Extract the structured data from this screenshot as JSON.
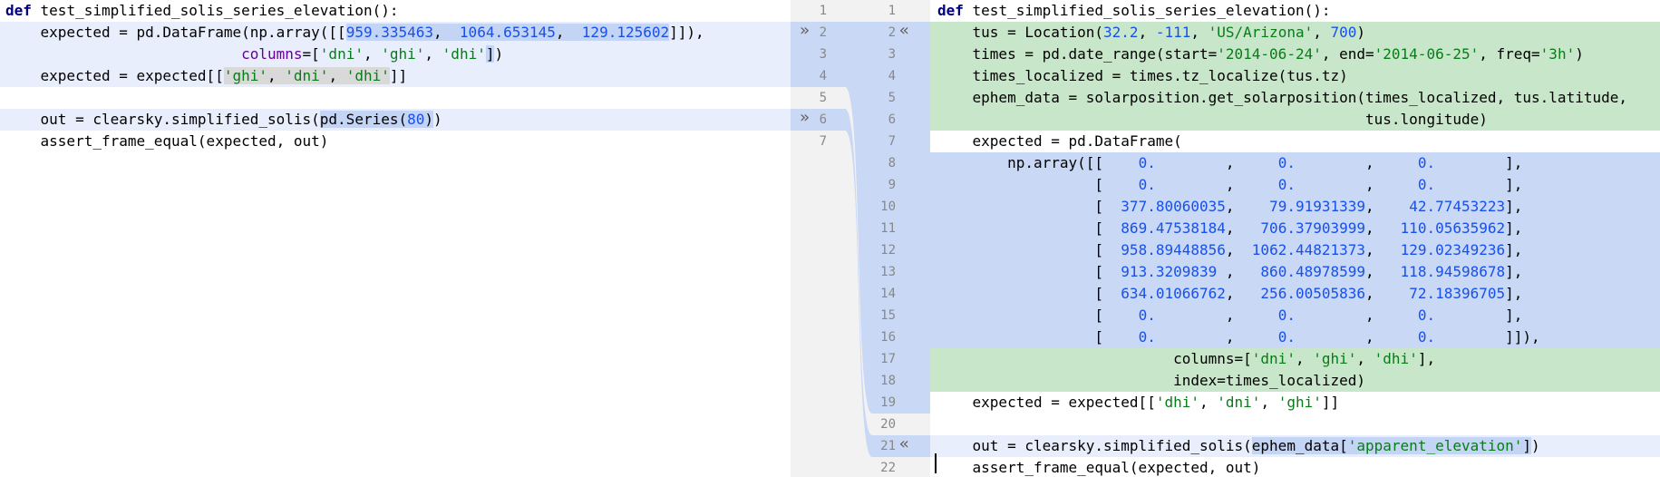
{
  "left": {
    "lines": [
      {
        "n": "1",
        "parts": [
          [
            "kw",
            "def"
          ],
          [
            "",
            " test_simplified_solis_series_elevation():"
          ]
        ]
      },
      {
        "n": "2",
        "parts": [
          [
            "",
            "    expected = pd.DataFrame(np.array([["
          ],
          [
            "num chg",
            "959.335463"
          ],
          [
            "chg",
            ",  "
          ],
          [
            "num chg",
            "1064.653145"
          ],
          [
            "chg",
            ",  "
          ],
          [
            "num chg",
            "129.125602"
          ],
          [
            "",
            "]]),"
          ]
        ]
      },
      {
        "n": "3",
        "parts": [
          [
            "",
            "                           "
          ],
          [
            "kwarg",
            "columns"
          ],
          [
            "",
            "=["
          ],
          [
            "str",
            "'dni'"
          ],
          [
            "",
            ", "
          ],
          [
            "str",
            "'ghi'"
          ],
          [
            "",
            ", "
          ],
          [
            "str",
            "'dhi'"
          ],
          [
            "chg",
            "]"
          ],
          [
            "",
            ")"
          ]
        ]
      },
      {
        "n": "4",
        "parts": [
          [
            "",
            "    expected = expected[["
          ],
          [
            "str grey",
            "'ghi'"
          ],
          [
            "grey",
            ", "
          ],
          [
            "str grey",
            "'dni'"
          ],
          [
            "grey",
            ", "
          ],
          [
            "str grey",
            "'dhi'"
          ],
          [
            "",
            "]]"
          ]
        ]
      },
      {
        "n": "5",
        "parts": [
          [
            "",
            ""
          ]
        ]
      },
      {
        "n": "6",
        "parts": [
          [
            "",
            "    out = clearsky.simplified_solis("
          ],
          [
            "chg",
            "pd.Series("
          ],
          [
            "num chg",
            "80"
          ],
          [
            "chg",
            ")"
          ],
          [
            "",
            ")"
          ]
        ]
      },
      {
        "n": "7",
        "parts": [
          [
            "",
            "    assert_frame_equal(expected, out)"
          ]
        ]
      }
    ]
  },
  "right": {
    "lines": [
      {
        "n": "1",
        "parts": [
          [
            "kw",
            "def"
          ],
          [
            "",
            " test_simplified_solis_series_elevation():"
          ]
        ]
      },
      {
        "n": "2",
        "parts": [
          [
            "",
            "    tus = Location("
          ],
          [
            "num",
            "32.2"
          ],
          [
            "",
            ", "
          ],
          [
            "num",
            "-111"
          ],
          [
            "",
            ", "
          ],
          [
            "str",
            "'US/Arizona'"
          ],
          [
            "",
            ", "
          ],
          [
            "num",
            "700"
          ],
          [
            "",
            ")"
          ]
        ]
      },
      {
        "n": "3",
        "parts": [
          [
            "",
            "    times = pd.date_range(start="
          ],
          [
            "str",
            "'2014-06-24'"
          ],
          [
            "",
            ", end="
          ],
          [
            "str",
            "'2014-06-25'"
          ],
          [
            "",
            ", freq="
          ],
          [
            "str",
            "'3h'"
          ],
          [
            "",
            ")"
          ]
        ]
      },
      {
        "n": "4",
        "parts": [
          [
            "",
            "    times_localized = times.tz_localize(tus.tz)"
          ]
        ]
      },
      {
        "n": "5",
        "parts": [
          [
            "",
            "    ephem_data = solarposition.get_solarposition(times_localized, tus.latitude,"
          ]
        ]
      },
      {
        "n": "6",
        "parts": [
          [
            "",
            "                                                 tus.longitude)"
          ]
        ]
      },
      {
        "n": "7",
        "parts": [
          [
            "",
            "    expected = pd.DataFrame("
          ]
        ]
      },
      {
        "n": "8",
        "parts": [
          [
            "",
            "        np.array([["
          ],
          [
            "num",
            "    0.        "
          ],
          [
            "",
            ",     "
          ],
          [
            "num",
            "0.        "
          ],
          [
            "",
            ",     "
          ],
          [
            "num",
            "0.        "
          ],
          [
            "",
            "],"
          ]
        ]
      },
      {
        "n": "9",
        "parts": [
          [
            "",
            "                  [    "
          ],
          [
            "num",
            "0.        "
          ],
          [
            "",
            ",     "
          ],
          [
            "num",
            "0.        "
          ],
          [
            "",
            ",     "
          ],
          [
            "num",
            "0.        "
          ],
          [
            "",
            "],"
          ]
        ]
      },
      {
        "n": "10",
        "parts": [
          [
            "",
            "                  [  "
          ],
          [
            "num",
            "377.80060035"
          ],
          [
            "",
            ",    "
          ],
          [
            "num",
            "79.91931339"
          ],
          [
            "",
            ",    "
          ],
          [
            "num",
            "42.77453223"
          ],
          [
            "",
            "],"
          ]
        ]
      },
      {
        "n": "11",
        "parts": [
          [
            "",
            "                  [  "
          ],
          [
            "num",
            "869.47538184"
          ],
          [
            "",
            ",   "
          ],
          [
            "num",
            "706.37903999"
          ],
          [
            "",
            ",   "
          ],
          [
            "num",
            "110.05635962"
          ],
          [
            "",
            "],"
          ]
        ]
      },
      {
        "n": "12",
        "parts": [
          [
            "",
            "                  [  "
          ],
          [
            "num",
            "958.89448856"
          ],
          [
            "",
            ",  "
          ],
          [
            "num",
            "1062.44821373"
          ],
          [
            "",
            ",   "
          ],
          [
            "num",
            "129.02349236"
          ],
          [
            "",
            "],"
          ]
        ]
      },
      {
        "n": "13",
        "parts": [
          [
            "",
            "                  [  "
          ],
          [
            "num",
            "913.3209839 "
          ],
          [
            "",
            ",   "
          ],
          [
            "num",
            "860.48978599"
          ],
          [
            "",
            ",   "
          ],
          [
            "num",
            "118.94598678"
          ],
          [
            "",
            "],"
          ]
        ]
      },
      {
        "n": "14",
        "parts": [
          [
            "",
            "                  [  "
          ],
          [
            "num",
            "634.01066762"
          ],
          [
            "",
            ",   "
          ],
          [
            "num",
            "256.00505836"
          ],
          [
            "",
            ",    "
          ],
          [
            "num",
            "72.18396705"
          ],
          [
            "",
            "],"
          ]
        ]
      },
      {
        "n": "15",
        "parts": [
          [
            "",
            "                  [    "
          ],
          [
            "num",
            "0.        "
          ],
          [
            "",
            ",     "
          ],
          [
            "num",
            "0.        "
          ],
          [
            "",
            ",     "
          ],
          [
            "num",
            "0.        "
          ],
          [
            "",
            "],"
          ]
        ]
      },
      {
        "n": "16",
        "parts": [
          [
            "",
            "                  [    "
          ],
          [
            "num",
            "0.        "
          ],
          [
            "",
            ",     "
          ],
          [
            "num",
            "0.        "
          ],
          [
            "",
            ",     "
          ],
          [
            "num",
            "0.        "
          ],
          [
            "",
            "]]),"
          ]
        ]
      },
      {
        "n": "17",
        "parts": [
          [
            "",
            "                           columns=["
          ],
          [
            "str",
            "'dni'"
          ],
          [
            "",
            ", "
          ],
          [
            "str",
            "'ghi'"
          ],
          [
            "",
            ", "
          ],
          [
            "str",
            "'dhi'"
          ],
          [
            "",
            "],"
          ]
        ]
      },
      {
        "n": "18",
        "parts": [
          [
            "",
            "                           index=times_localized)"
          ]
        ]
      },
      {
        "n": "19",
        "parts": [
          [
            "",
            "    expected = expected[["
          ],
          [
            "str",
            "'dhi'"
          ],
          [
            "",
            ", "
          ],
          [
            "str",
            "'dni'"
          ],
          [
            "",
            ", "
          ],
          [
            "str",
            "'ghi'"
          ],
          [
            "",
            "]]"
          ]
        ]
      },
      {
        "n": "20",
        "parts": [
          [
            "",
            ""
          ]
        ]
      },
      {
        "n": "21",
        "parts": [
          [
            "",
            "    out = clearsky.simplified_solis("
          ],
          [
            "chg",
            "ephem_data["
          ],
          [
            "str chg",
            "'apparent_elevation'"
          ],
          [
            "chg",
            "]"
          ],
          [
            "",
            ")"
          ]
        ]
      },
      {
        "n": "22",
        "parts": [
          [
            "",
            "    assert_frame_equal(expected, out)"
          ]
        ]
      }
    ]
  },
  "gutter": {
    "left_arrow_label": "»",
    "right_arrow_label": "«"
  }
}
